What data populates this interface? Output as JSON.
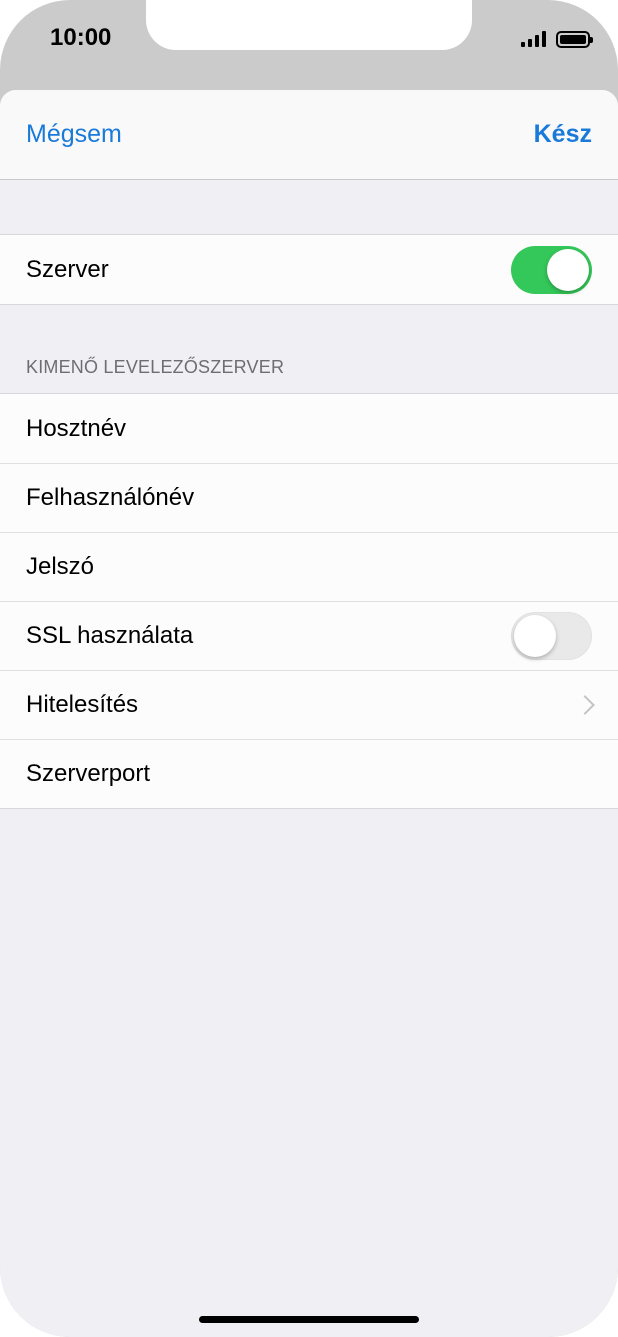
{
  "status_bar": {
    "time": "10:00"
  },
  "navbar": {
    "cancel_label": "Mégsem",
    "done_label": "Kész"
  },
  "server_group": {
    "label": "Szerver",
    "toggle_on": true
  },
  "outgoing": {
    "header": "KIMENŐ LEVELEZŐSZERVER",
    "rows": [
      {
        "label": "Hosztnév"
      },
      {
        "label": "Felhasználónév"
      },
      {
        "label": "Jelszó"
      },
      {
        "label": "SSL használata",
        "toggle_on": false
      },
      {
        "label": "Hitelesítés",
        "accessory": "chevron-right-icon"
      },
      {
        "label": "Szerverport"
      }
    ]
  },
  "colors": {
    "accent": "#1a7ad9",
    "toggle_on": "#34c759",
    "background": "#efeff4"
  }
}
